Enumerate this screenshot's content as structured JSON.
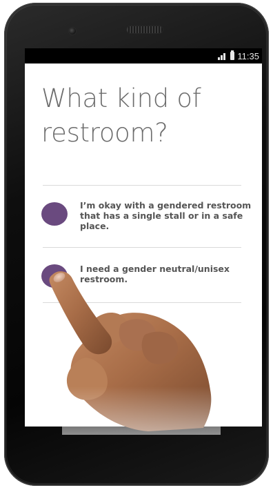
{
  "status_bar": {
    "time": "11:35",
    "icons": [
      "signal-icon",
      "battery-icon"
    ]
  },
  "screen": {
    "title": "What kind of restroom?",
    "options": [
      {
        "label": "I’m okay with a gendered restroom that has a single stall or in a safe place.",
        "selected": false
      },
      {
        "label": "I need a gender neutral/unisex restroom.",
        "selected": false
      }
    ]
  },
  "colors": {
    "accent": "#6a4a7f",
    "title_text": "#6c6c6c",
    "body_text": "#555555",
    "divider": "#d9d9d9",
    "phone_body": "#0e0e0e",
    "skin": "#b07a55"
  },
  "illustration": {
    "hand": "hand-pointing-finger-image"
  }
}
